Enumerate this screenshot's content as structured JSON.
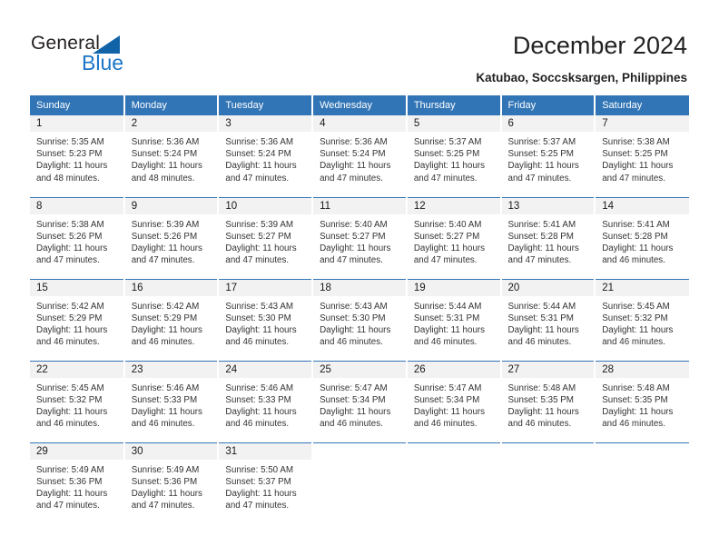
{
  "brand": {
    "name_part1": "General",
    "name_part2": "Blue",
    "triangle_color": "#1163a8",
    "blue_color": "#1b76c7"
  },
  "header": {
    "title": "December 2024",
    "subtitle": "Katubao, Soccsksargen, Philippines"
  },
  "theme": {
    "header_bg": "#3275b6",
    "header_text": "#ffffff",
    "daynum_bg": "#f2f2f2",
    "row_divider": "#3275b6"
  },
  "weekdays": [
    "Sunday",
    "Monday",
    "Tuesday",
    "Wednesday",
    "Thursday",
    "Friday",
    "Saturday"
  ],
  "weeks": [
    [
      {
        "day": "1",
        "sunrise": "Sunrise: 5:35 AM",
        "sunset": "Sunset: 5:23 PM",
        "daylight_line1": "Daylight: 11 hours",
        "daylight_line2": "and 48 minutes."
      },
      {
        "day": "2",
        "sunrise": "Sunrise: 5:36 AM",
        "sunset": "Sunset: 5:24 PM",
        "daylight_line1": "Daylight: 11 hours",
        "daylight_line2": "and 48 minutes."
      },
      {
        "day": "3",
        "sunrise": "Sunrise: 5:36 AM",
        "sunset": "Sunset: 5:24 PM",
        "daylight_line1": "Daylight: 11 hours",
        "daylight_line2": "and 47 minutes."
      },
      {
        "day": "4",
        "sunrise": "Sunrise: 5:36 AM",
        "sunset": "Sunset: 5:24 PM",
        "daylight_line1": "Daylight: 11 hours",
        "daylight_line2": "and 47 minutes."
      },
      {
        "day": "5",
        "sunrise": "Sunrise: 5:37 AM",
        "sunset": "Sunset: 5:25 PM",
        "daylight_line1": "Daylight: 11 hours",
        "daylight_line2": "and 47 minutes."
      },
      {
        "day": "6",
        "sunrise": "Sunrise: 5:37 AM",
        "sunset": "Sunset: 5:25 PM",
        "daylight_line1": "Daylight: 11 hours",
        "daylight_line2": "and 47 minutes."
      },
      {
        "day": "7",
        "sunrise": "Sunrise: 5:38 AM",
        "sunset": "Sunset: 5:25 PM",
        "daylight_line1": "Daylight: 11 hours",
        "daylight_line2": "and 47 minutes."
      }
    ],
    [
      {
        "day": "8",
        "sunrise": "Sunrise: 5:38 AM",
        "sunset": "Sunset: 5:26 PM",
        "daylight_line1": "Daylight: 11 hours",
        "daylight_line2": "and 47 minutes."
      },
      {
        "day": "9",
        "sunrise": "Sunrise: 5:39 AM",
        "sunset": "Sunset: 5:26 PM",
        "daylight_line1": "Daylight: 11 hours",
        "daylight_line2": "and 47 minutes."
      },
      {
        "day": "10",
        "sunrise": "Sunrise: 5:39 AM",
        "sunset": "Sunset: 5:27 PM",
        "daylight_line1": "Daylight: 11 hours",
        "daylight_line2": "and 47 minutes."
      },
      {
        "day": "11",
        "sunrise": "Sunrise: 5:40 AM",
        "sunset": "Sunset: 5:27 PM",
        "daylight_line1": "Daylight: 11 hours",
        "daylight_line2": "and 47 minutes."
      },
      {
        "day": "12",
        "sunrise": "Sunrise: 5:40 AM",
        "sunset": "Sunset: 5:27 PM",
        "daylight_line1": "Daylight: 11 hours",
        "daylight_line2": "and 47 minutes."
      },
      {
        "day": "13",
        "sunrise": "Sunrise: 5:41 AM",
        "sunset": "Sunset: 5:28 PM",
        "daylight_line1": "Daylight: 11 hours",
        "daylight_line2": "and 47 minutes."
      },
      {
        "day": "14",
        "sunrise": "Sunrise: 5:41 AM",
        "sunset": "Sunset: 5:28 PM",
        "daylight_line1": "Daylight: 11 hours",
        "daylight_line2": "and 46 minutes."
      }
    ],
    [
      {
        "day": "15",
        "sunrise": "Sunrise: 5:42 AM",
        "sunset": "Sunset: 5:29 PM",
        "daylight_line1": "Daylight: 11 hours",
        "daylight_line2": "and 46 minutes."
      },
      {
        "day": "16",
        "sunrise": "Sunrise: 5:42 AM",
        "sunset": "Sunset: 5:29 PM",
        "daylight_line1": "Daylight: 11 hours",
        "daylight_line2": "and 46 minutes."
      },
      {
        "day": "17",
        "sunrise": "Sunrise: 5:43 AM",
        "sunset": "Sunset: 5:30 PM",
        "daylight_line1": "Daylight: 11 hours",
        "daylight_line2": "and 46 minutes."
      },
      {
        "day": "18",
        "sunrise": "Sunrise: 5:43 AM",
        "sunset": "Sunset: 5:30 PM",
        "daylight_line1": "Daylight: 11 hours",
        "daylight_line2": "and 46 minutes."
      },
      {
        "day": "19",
        "sunrise": "Sunrise: 5:44 AM",
        "sunset": "Sunset: 5:31 PM",
        "daylight_line1": "Daylight: 11 hours",
        "daylight_line2": "and 46 minutes."
      },
      {
        "day": "20",
        "sunrise": "Sunrise: 5:44 AM",
        "sunset": "Sunset: 5:31 PM",
        "daylight_line1": "Daylight: 11 hours",
        "daylight_line2": "and 46 minutes."
      },
      {
        "day": "21",
        "sunrise": "Sunrise: 5:45 AM",
        "sunset": "Sunset: 5:32 PM",
        "daylight_line1": "Daylight: 11 hours",
        "daylight_line2": "and 46 minutes."
      }
    ],
    [
      {
        "day": "22",
        "sunrise": "Sunrise: 5:45 AM",
        "sunset": "Sunset: 5:32 PM",
        "daylight_line1": "Daylight: 11 hours",
        "daylight_line2": "and 46 minutes."
      },
      {
        "day": "23",
        "sunrise": "Sunrise: 5:46 AM",
        "sunset": "Sunset: 5:33 PM",
        "daylight_line1": "Daylight: 11 hours",
        "daylight_line2": "and 46 minutes."
      },
      {
        "day": "24",
        "sunrise": "Sunrise: 5:46 AM",
        "sunset": "Sunset: 5:33 PM",
        "daylight_line1": "Daylight: 11 hours",
        "daylight_line2": "and 46 minutes."
      },
      {
        "day": "25",
        "sunrise": "Sunrise: 5:47 AM",
        "sunset": "Sunset: 5:34 PM",
        "daylight_line1": "Daylight: 11 hours",
        "daylight_line2": "and 46 minutes."
      },
      {
        "day": "26",
        "sunrise": "Sunrise: 5:47 AM",
        "sunset": "Sunset: 5:34 PM",
        "daylight_line1": "Daylight: 11 hours",
        "daylight_line2": "and 46 minutes."
      },
      {
        "day": "27",
        "sunrise": "Sunrise: 5:48 AM",
        "sunset": "Sunset: 5:35 PM",
        "daylight_line1": "Daylight: 11 hours",
        "daylight_line2": "and 46 minutes."
      },
      {
        "day": "28",
        "sunrise": "Sunrise: 5:48 AM",
        "sunset": "Sunset: 5:35 PM",
        "daylight_line1": "Daylight: 11 hours",
        "daylight_line2": "and 46 minutes."
      }
    ],
    [
      {
        "day": "29",
        "sunrise": "Sunrise: 5:49 AM",
        "sunset": "Sunset: 5:36 PM",
        "daylight_line1": "Daylight: 11 hours",
        "daylight_line2": "and 47 minutes."
      },
      {
        "day": "30",
        "sunrise": "Sunrise: 5:49 AM",
        "sunset": "Sunset: 5:36 PM",
        "daylight_line1": "Daylight: 11 hours",
        "daylight_line2": "and 47 minutes."
      },
      {
        "day": "31",
        "sunrise": "Sunrise: 5:50 AM",
        "sunset": "Sunset: 5:37 PM",
        "daylight_line1": "Daylight: 11 hours",
        "daylight_line2": "and 47 minutes."
      },
      {
        "day": "",
        "sunrise": "",
        "sunset": "",
        "daylight_line1": "",
        "daylight_line2": ""
      },
      {
        "day": "",
        "sunrise": "",
        "sunset": "",
        "daylight_line1": "",
        "daylight_line2": ""
      },
      {
        "day": "",
        "sunrise": "",
        "sunset": "",
        "daylight_line1": "",
        "daylight_line2": ""
      },
      {
        "day": "",
        "sunrise": "",
        "sunset": "",
        "daylight_line1": "",
        "daylight_line2": ""
      }
    ]
  ]
}
